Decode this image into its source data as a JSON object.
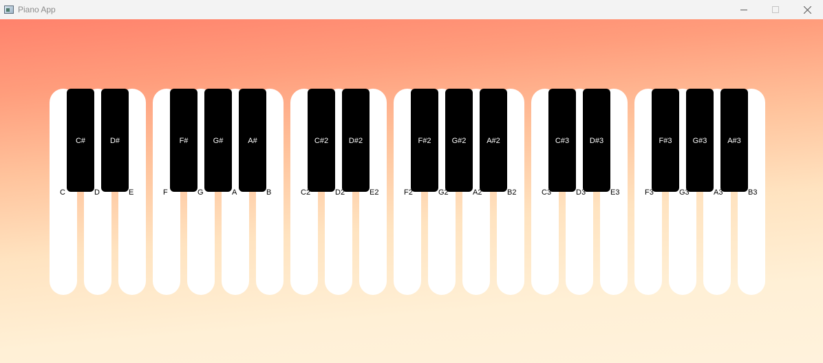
{
  "window": {
    "title": "Piano App",
    "icon": "app-window-icon",
    "controls": [
      "minimize-icon",
      "maximize-icon",
      "close-icon"
    ]
  },
  "colors": {
    "titlebar": "#f3f3f3",
    "gradient_top": "#ff826c",
    "gradient_bottom": "#fff2dc",
    "white_key": "#ffffff",
    "black_key": "#000000"
  },
  "piano": {
    "white_keys": [
      "C",
      "D",
      "E",
      "F",
      "G",
      "A",
      "B",
      "C2",
      "D2",
      "E2",
      "F2",
      "G2",
      "A2",
      "B2",
      "C3",
      "D3",
      "E3",
      "F3",
      "G3",
      "A3",
      "B3"
    ],
    "black_keys": [
      "C#",
      "D#",
      "F#",
      "G#",
      "A#",
      "C#2",
      "D#2",
      "F#2",
      "G#2",
      "A#2",
      "C#3",
      "D#3",
      "F#3",
      "G#3",
      "A#3"
    ]
  }
}
